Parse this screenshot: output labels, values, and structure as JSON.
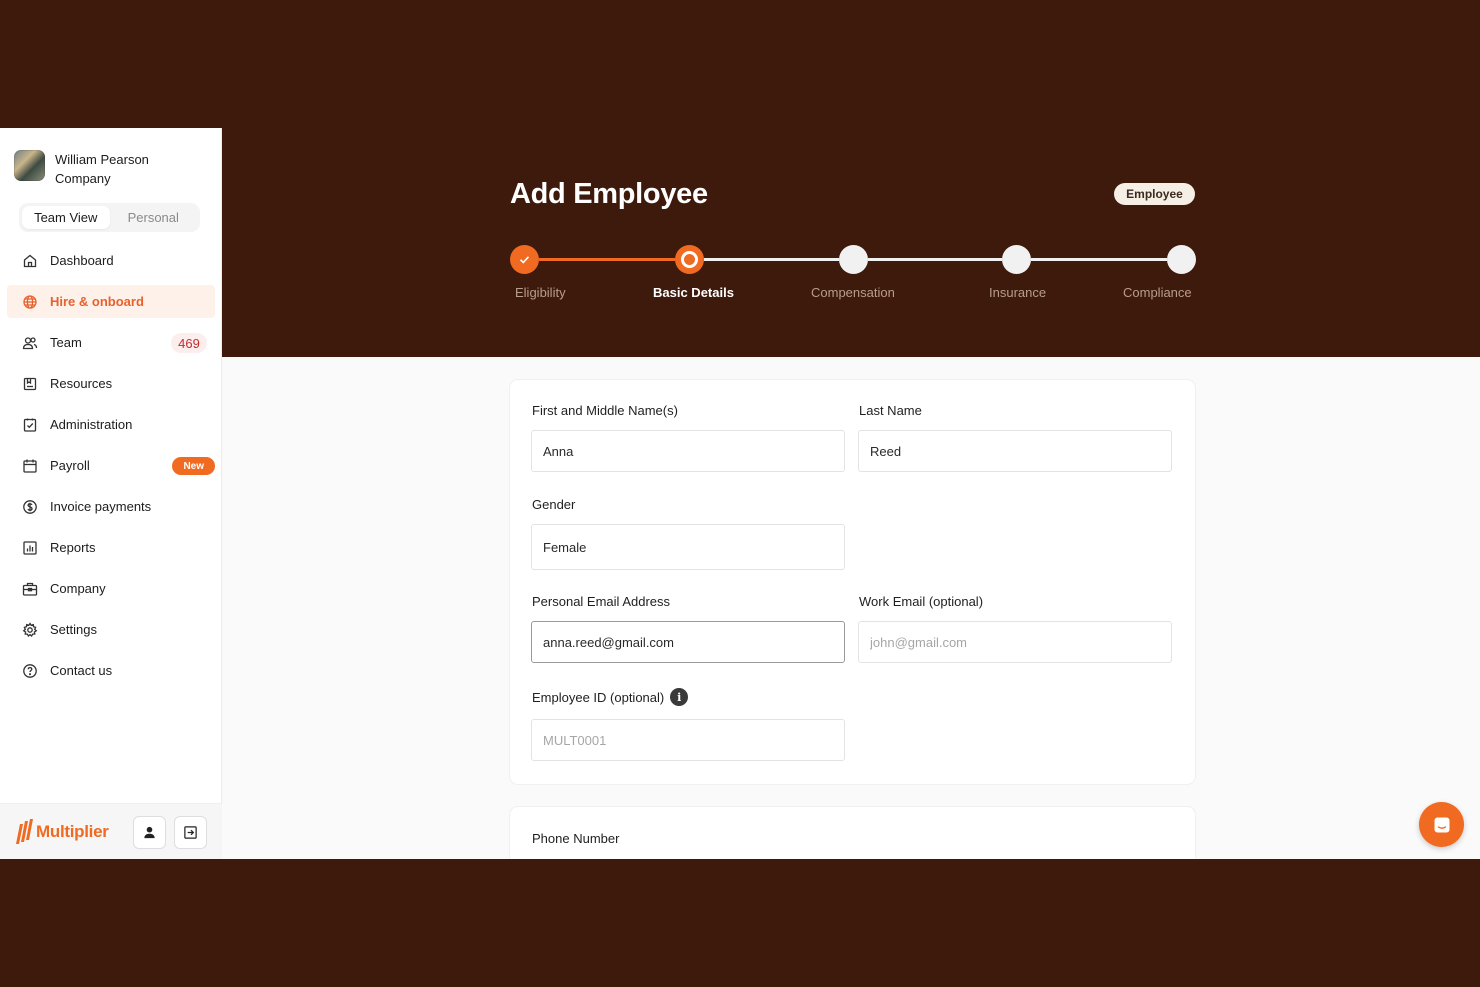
{
  "account": {
    "name": "William Pearson",
    "org": "Company"
  },
  "view_toggle": {
    "team": "Team View",
    "personal": "Personal",
    "active": "team"
  },
  "nav": {
    "items": [
      {
        "label": "Dashboard",
        "icon": "home-icon"
      },
      {
        "label": "Hire & onboard",
        "icon": "globe-icon",
        "active": true
      },
      {
        "label": "Team",
        "icon": "team-icon",
        "count": "469"
      },
      {
        "label": "Resources",
        "icon": "resources-icon"
      },
      {
        "label": "Administration",
        "icon": "clipboard-check-icon"
      },
      {
        "label": "Payroll",
        "icon": "calendar-icon",
        "badge": "New"
      },
      {
        "label": "Invoice payments",
        "icon": "dollar-icon"
      },
      {
        "label": "Reports",
        "icon": "bar-chart-icon"
      },
      {
        "label": "Company",
        "icon": "briefcase-icon"
      },
      {
        "label": "Settings",
        "icon": "gear-icon"
      },
      {
        "label": "Contact us",
        "icon": "help-icon"
      }
    ]
  },
  "footer": {
    "brand": "Multiplier"
  },
  "header": {
    "title": "Add Employee",
    "type_badge": "Employee"
  },
  "stepper": {
    "steps": [
      {
        "label": "Eligibility",
        "state": "done"
      },
      {
        "label": "Basic Details",
        "state": "current"
      },
      {
        "label": "Compensation",
        "state": "upcoming"
      },
      {
        "label": "Insurance",
        "state": "upcoming"
      },
      {
        "label": "Compliance",
        "state": "upcoming"
      }
    ]
  },
  "form": {
    "first_name": {
      "label": "First and Middle Name(s)",
      "value": "Anna"
    },
    "last_name": {
      "label": "Last Name",
      "value": "Reed"
    },
    "gender": {
      "label": "Gender",
      "value": "Female"
    },
    "personal_email": {
      "label": "Personal Email Address",
      "value": "anna.reed@gmail.com"
    },
    "work_email": {
      "label": "Work Email (optional)",
      "value": "",
      "placeholder": "john@gmail.com"
    },
    "employee_id": {
      "label": "Employee ID (optional)",
      "value": "",
      "placeholder": "MULT0001"
    },
    "phone": {
      "label": "Phone Number"
    }
  },
  "colors": {
    "brand_orange": "#f06a22",
    "banner_brown": "#3d1a0c",
    "badge_red": "#c52b2b"
  }
}
